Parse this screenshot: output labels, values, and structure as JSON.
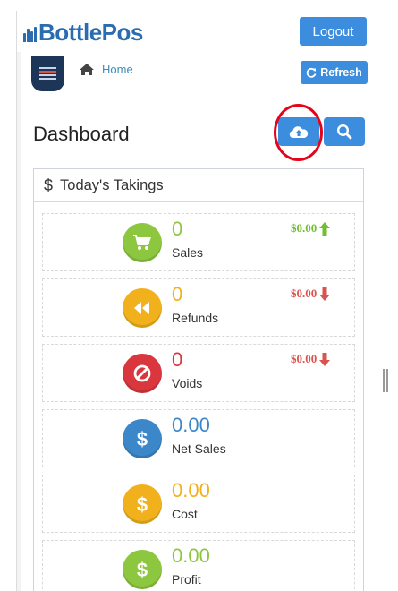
{
  "app": {
    "logo_text": "BottlePos",
    "logout_label": "Logout"
  },
  "breadcrumb": {
    "home_label": "Home"
  },
  "toolbar": {
    "refresh_label": "Refresh"
  },
  "page": {
    "title": "Dashboard"
  },
  "takings": {
    "title": "Today's Takings",
    "currency_symbol": "$",
    "stats": [
      {
        "label": "Sales",
        "value": "0",
        "amount": "$0.00",
        "trend": "up",
        "icon": "cart-icon",
        "color": "#8dc63f"
      },
      {
        "label": "Refunds",
        "value": "0",
        "amount": "$0.00",
        "trend": "down",
        "icon": "rewind-icon",
        "color": "#f0b11c"
      },
      {
        "label": "Voids",
        "value": "0",
        "amount": "$0.00",
        "trend": "down",
        "icon": "ban-icon",
        "color": "#d9363e"
      },
      {
        "label": "Net Sales",
        "value": "0.00",
        "icon": "dollar-icon",
        "color": "#3b87c9"
      },
      {
        "label": "Cost",
        "value": "0.00",
        "icon": "dollar-icon",
        "color": "#f0b11c"
      },
      {
        "label": "Profit",
        "value": "0.00",
        "icon": "dollar-icon",
        "color": "#8dc63f"
      }
    ]
  },
  "colors": {
    "primary_button": "#3c8dde",
    "link": "#3c8dbc",
    "trend_up": "#6fbf2e",
    "trend_down": "#d9534f",
    "highlight_ring": "#e3061b"
  }
}
